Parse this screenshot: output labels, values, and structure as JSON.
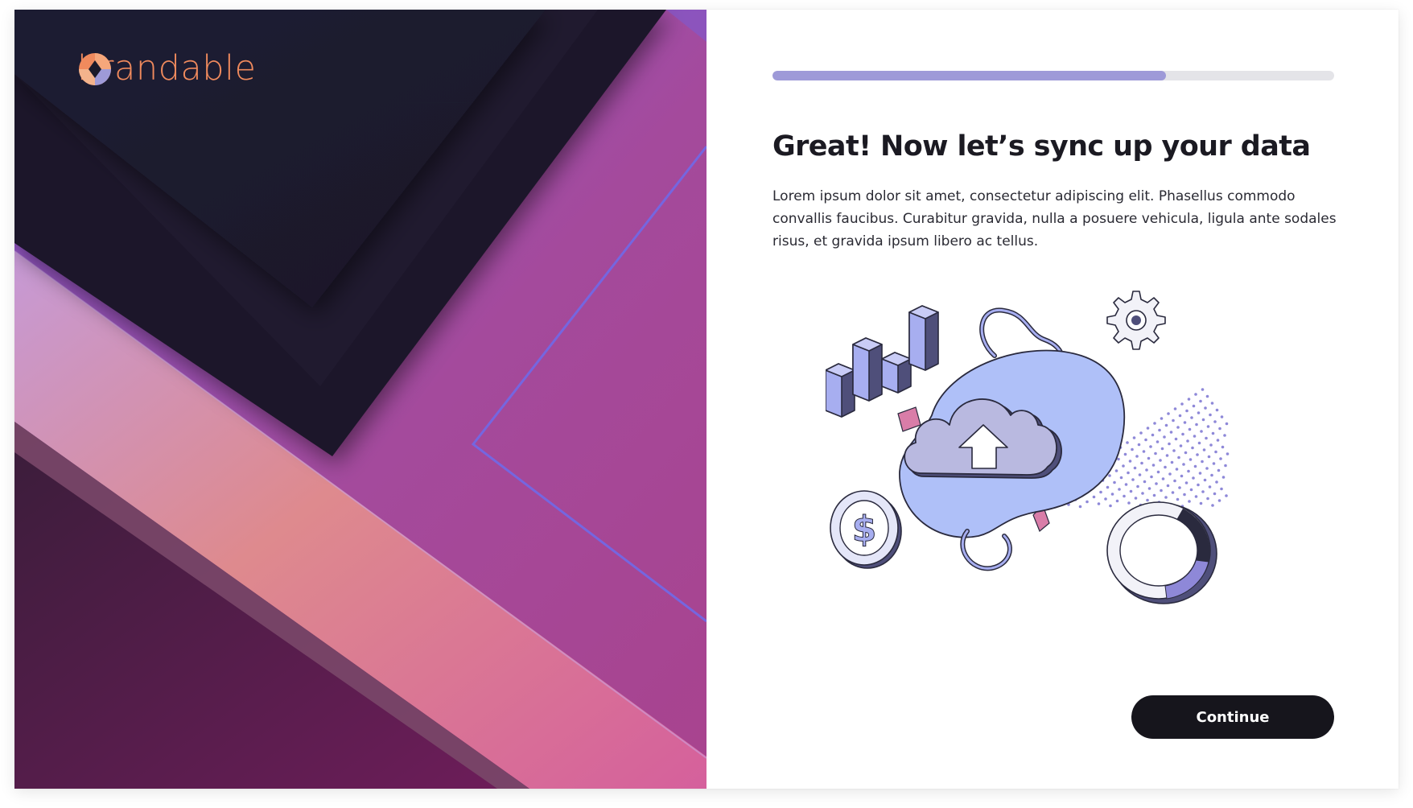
{
  "brand": {
    "name": "brandable",
    "logo_icon": "brandable-logo-icon",
    "text_color": "#F08A5D"
  },
  "progress": {
    "value_percent": 70,
    "fill_color": "#9E9AD8",
    "track_color": "#E4E4E8"
  },
  "main": {
    "title": "Great! Now let’s sync up your data",
    "description": "Lorem ipsum dolor sit amet, consectetur adipiscing elit. Phasellus commodo convallis faucibus. Curabitur gravida, nulla a posuere vehicula, ligula ante sodales risus, et gravida ipsum libero ac tellus.",
    "illustration_icon": "cloud-upload-icon"
  },
  "actions": {
    "continue_label": "Continue",
    "button_color": "#16151C"
  }
}
